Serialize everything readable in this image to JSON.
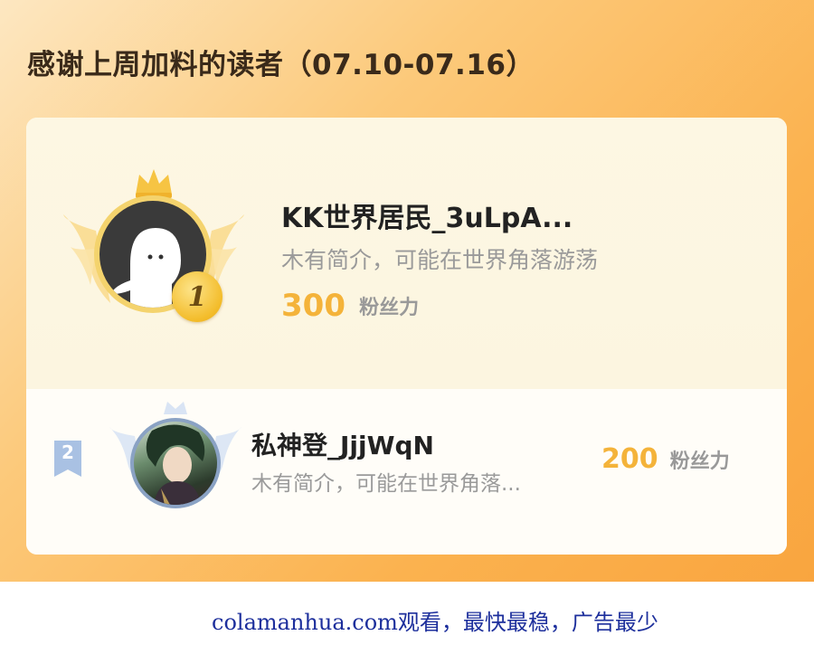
{
  "header": {
    "title": "感谢上周加料的读者（07.10-07.16）"
  },
  "ranking": [
    {
      "rank": "1",
      "name": "KK世界居民_3uLpA...",
      "bio": "木有简介，可能在世界角落游荡",
      "fans": "300",
      "fans_unit": "粉丝力"
    },
    {
      "rank": "2",
      "name": "私神登_JjjWqN",
      "bio": "木有简介，可能在世界角落...",
      "fans": "200",
      "fans_unit": "粉丝力"
    }
  ],
  "footer": {
    "text": "colamanhua.com观看，最快最稳，广告最少"
  },
  "colors": {
    "accent_gold": "#f4b33a",
    "banner_orange": "#f9a53f",
    "footer_blue": "#1d2f9c"
  },
  "icons": {
    "first_place": [
      "crown-icon",
      "wings-icon",
      "medal-icon"
    ],
    "second_place": [
      "ribbon-badge-icon",
      "wings-icon"
    ]
  }
}
